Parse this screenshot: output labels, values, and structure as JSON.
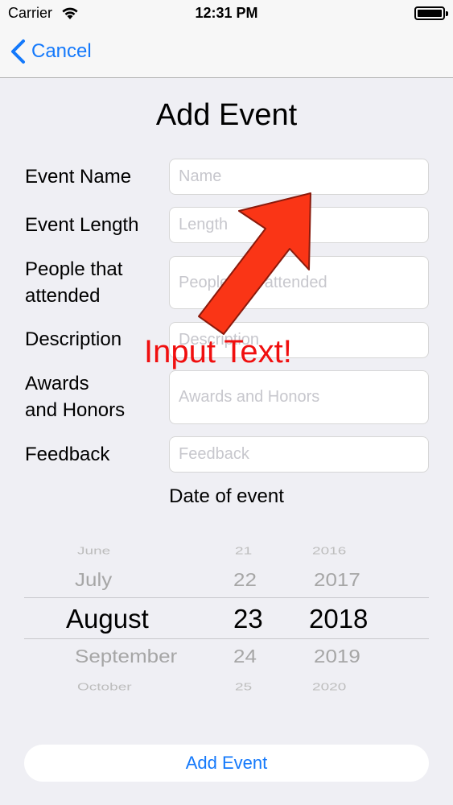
{
  "status_bar": {
    "carrier": "Carrier",
    "time": "12:31 PM"
  },
  "nav": {
    "back_label": "Cancel"
  },
  "page": {
    "title": "Add Event"
  },
  "form": {
    "event_name": {
      "label": "Event Name",
      "placeholder": "Name"
    },
    "event_length": {
      "label": "Event Length",
      "placeholder": "Length"
    },
    "people": {
      "label_line1": "People that",
      "label_line2": "attended",
      "placeholder": "People that attended"
    },
    "description": {
      "label": "Description",
      "placeholder": "Description"
    },
    "awards": {
      "label_line1": "Awards",
      "label_line2": "and Honors",
      "placeholder": "Awards and Honors"
    },
    "feedback": {
      "label": "Feedback",
      "placeholder": "Feedback"
    }
  },
  "date": {
    "label": "Date of event",
    "months": [
      "June",
      "July",
      "August",
      "September",
      "October"
    ],
    "days": [
      "21",
      "22",
      "23",
      "24",
      "25"
    ],
    "years": [
      "2016",
      "2017",
      "2018",
      "2019",
      "2020"
    ],
    "selected": {
      "month": "August",
      "day": "23",
      "year": "2018"
    }
  },
  "actions": {
    "add_event_label": "Add Event"
  },
  "annotation": {
    "text": "Input Text!",
    "color": "#f00f0f"
  },
  "colors": {
    "accent": "#1479fb",
    "background": "#efeff4",
    "placeholder": "#c7c7cd"
  }
}
